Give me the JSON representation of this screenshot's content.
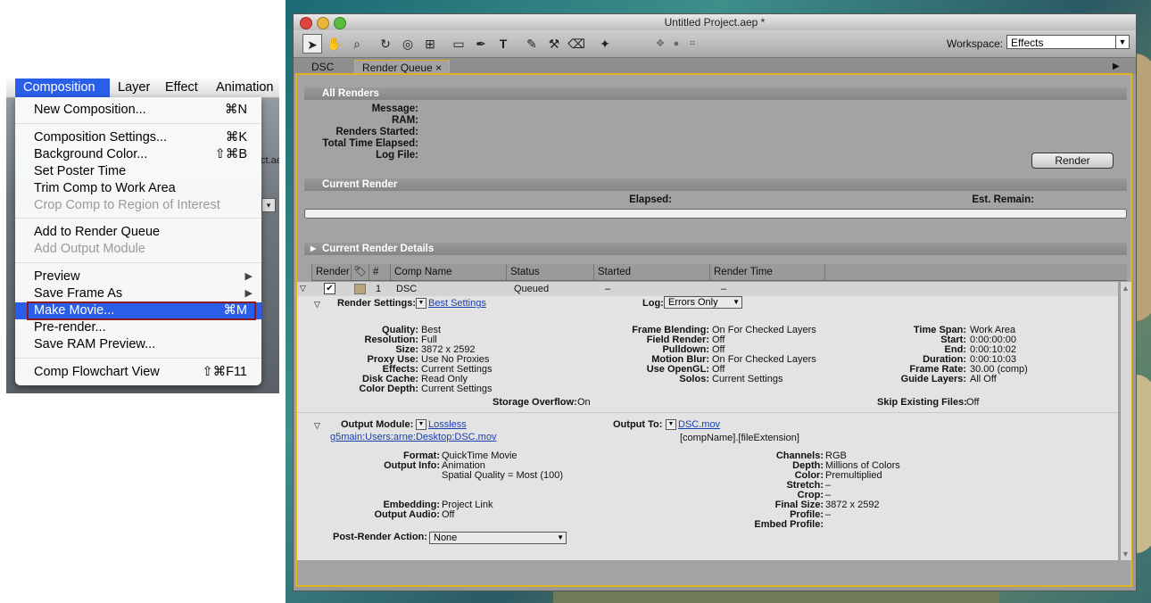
{
  "menu": {
    "menubar": [
      "Composition",
      "Layer",
      "Effect",
      "Animation"
    ],
    "items": [
      {
        "label": "New Composition...",
        "shortcut": "⌘N"
      },
      {
        "label": "Composition Settings...",
        "shortcut": "⌘K"
      },
      {
        "label": "Background Color...",
        "shortcut": "⇧⌘B"
      },
      {
        "label": "Set Poster Time",
        "shortcut": ""
      },
      {
        "label": "Trim Comp to Work Area",
        "shortcut": ""
      },
      {
        "label": "Crop Comp to Region of Interest",
        "shortcut": ""
      },
      {
        "label": "Add to Render Queue",
        "shortcut": ""
      },
      {
        "label": "Add Output Module",
        "shortcut": ""
      },
      {
        "label": "Preview",
        "shortcut": ""
      },
      {
        "label": "Save Frame As",
        "shortcut": ""
      },
      {
        "label": "Make Movie...",
        "shortcut": "⌘M"
      },
      {
        "label": "Pre-render...",
        "shortcut": ""
      },
      {
        "label": "Save RAM Preview...",
        "shortcut": ""
      },
      {
        "label": "Comp Flowchart View",
        "shortcut": "⇧⌘F11"
      }
    ],
    "bg_fragments": [
      "ct.ae"
    ]
  },
  "window": {
    "title": "Untitled Project.aep *",
    "workspace_label": "Workspace:",
    "workspace_value": "Effects",
    "tabs": [
      "DSC",
      "Render Queue"
    ],
    "tab_close": "×"
  },
  "all_renders": {
    "title": "All Renders",
    "labels": [
      "Message:",
      "RAM:",
      "Renders Started:",
      "Total Time Elapsed:",
      "Log File:"
    ],
    "render_button": "Render"
  },
  "current_render": {
    "title": "Current Render",
    "elapsed": "Elapsed:",
    "est_remain": "Est. Remain:",
    "details_title": "Current Render Details"
  },
  "queue": {
    "columns": [
      "Render",
      "#",
      "Comp Name",
      "Status",
      "Started",
      "Render Time"
    ],
    "row": {
      "num": "1",
      "comp": "DSC",
      "status": "Queued",
      "started": "–",
      "render_time": "–"
    },
    "render_settings_label": "Render Settings:",
    "render_settings_value": "Best Settings",
    "log_label": "Log:",
    "log_value": "Errors Only",
    "col1": [
      [
        "Quality:",
        "Best"
      ],
      [
        "Resolution:",
        "Full"
      ],
      [
        "Size:",
        "3872 x 2592"
      ],
      [
        "Proxy Use:",
        "Use No Proxies"
      ],
      [
        "Effects:",
        "Current Settings"
      ],
      [
        "Disk Cache:",
        "Read Only"
      ],
      [
        "Color Depth:",
        "Current Settings"
      ]
    ],
    "col2": [
      [
        "Frame Blending:",
        "On For Checked Layers"
      ],
      [
        "Field Render:",
        "Off"
      ],
      [
        "Pulldown:",
        "Off"
      ],
      [
        "Motion Blur:",
        "On For Checked Layers"
      ],
      [
        "Use OpenGL:",
        "Off"
      ],
      [
        "Solos:",
        "Current Settings"
      ]
    ],
    "col3": [
      [
        "Time Span:",
        "Work Area"
      ],
      [
        "Start:",
        "0:00:00:00"
      ],
      [
        "End:",
        "0:00:10:02"
      ],
      [
        "Duration:",
        "0:00:10:03"
      ],
      [
        "Frame Rate:",
        "30.00 (comp)"
      ],
      [
        "Guide Layers:",
        "All Off"
      ]
    ],
    "storage_overflow_label": "Storage Overflow:",
    "storage_overflow_value": "On",
    "skip_existing_label": "Skip Existing Files:",
    "skip_existing_value": "Off",
    "output_module_label": "Output Module:",
    "output_module_value": "Lossless",
    "output_path": "g5main:Users:arne:Desktop:DSC.mov",
    "output_to_label": "Output To:",
    "output_to_value": "DSC.mov",
    "output_template": "[compName].[fileExtension]",
    "om_col1": [
      [
        "Format:",
        "QuickTime Movie"
      ],
      [
        "Output Info:",
        "Animation"
      ],
      [
        "",
        "Spatial Quality = Most (100)"
      ]
    ],
    "om_col1b": [
      [
        "Embedding:",
        "Project Link"
      ],
      [
        "Output Audio:",
        "Off"
      ]
    ],
    "om_col2": [
      [
        "Channels:",
        "RGB"
      ],
      [
        "Depth:",
        "Millions of Colors"
      ],
      [
        "Color:",
        "Premultiplied"
      ],
      [
        "Stretch:",
        "–"
      ],
      [
        "Crop:",
        "–"
      ],
      [
        "Final Size:",
        "3872 x 2592"
      ],
      [
        "Profile:",
        "–"
      ],
      [
        "Embed Profile:",
        ""
      ]
    ],
    "post_render_label": "Post-Render Action:",
    "post_render_value": "None"
  },
  "colors": {
    "highlight": "#2a5ee8",
    "panel_border": "#e0b21e",
    "hl_box": "#8b1a1a"
  }
}
